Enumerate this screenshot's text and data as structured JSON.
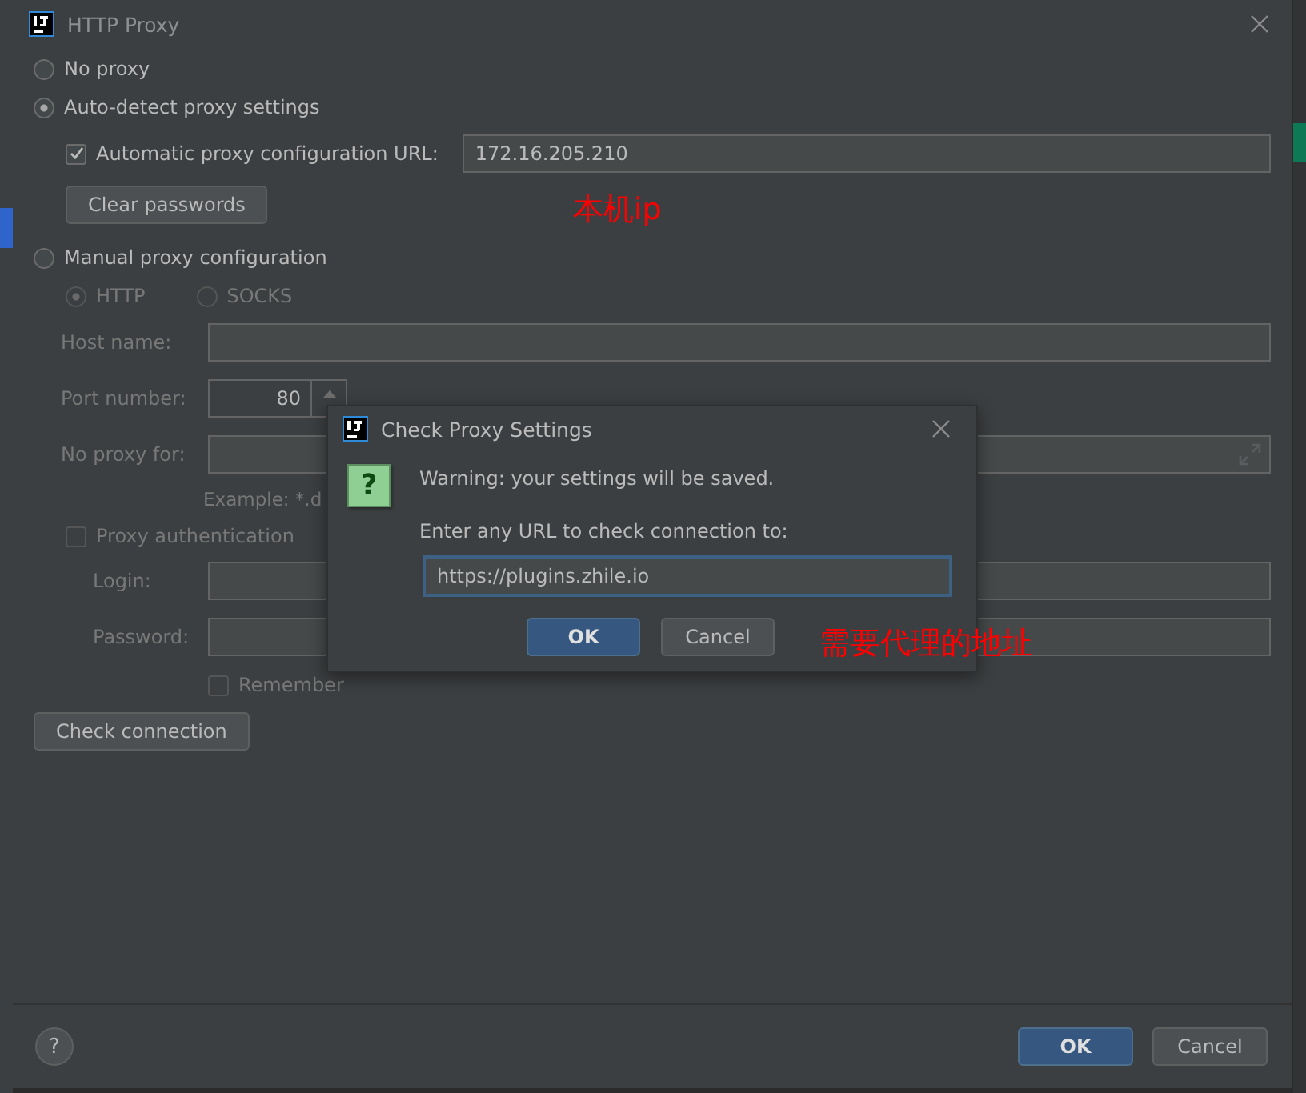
{
  "window": {
    "title": "HTTP Proxy"
  },
  "proxy_modes": [
    {
      "kind": "none",
      "label": "No proxy",
      "selected": false
    },
    {
      "kind": "auto",
      "label": "Auto-detect proxy settings",
      "selected": true,
      "pac_url": {
        "label": "Automatic proxy configuration URL:",
        "checked": true,
        "value": "172.16.205.210"
      },
      "clear_button": "Clear passwords"
    },
    {
      "kind": "manual",
      "label": "Manual proxy configuration",
      "selected": false,
      "disabled": true,
      "protocols": [
        {
          "label": "HTTP",
          "selected": true
        },
        {
          "label": "SOCKS",
          "selected": false
        }
      ],
      "host_name": {
        "label": "Host name:"
      },
      "port_number": {
        "label": "Port number:",
        "value": "80"
      },
      "no_proxy_for": {
        "label": "No proxy for:",
        "example": "Example: *.d"
      },
      "proxy_authentication": {
        "label": "Proxy authentication",
        "checked": false
      },
      "login": {
        "label": "Login:"
      },
      "password": {
        "label": "Password:"
      },
      "remember": {
        "label": "Remember",
        "checked": false
      }
    }
  ],
  "check_button": "Check connection",
  "help_button": "?",
  "buttons": [
    {
      "label": "OK",
      "kind": "primary"
    },
    {
      "label": "Cancel",
      "kind": "secondary"
    }
  ],
  "check_dialog": {
    "title": "Check Proxy Settings",
    "icon": "?",
    "message": "Warning: your settings will be saved.",
    "prompt": "Enter any URL to check connection to:",
    "url": "https://plugins.zhile.io",
    "buttons": [
      {
        "label": "OK",
        "kind": "primary"
      },
      {
        "label": "Cancel",
        "kind": "secondary"
      }
    ]
  },
  "annotations": [
    {
      "text": "本机ip"
    },
    {
      "text": "需要代理的地址"
    }
  ]
}
